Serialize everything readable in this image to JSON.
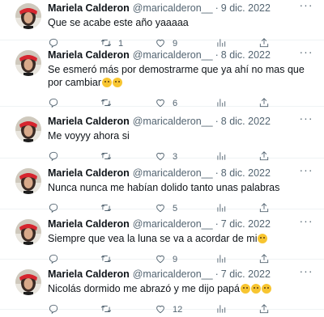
{
  "tweets": [
    {
      "name": "Mariela Calderon",
      "handle": "@maricalderon__",
      "separator": "·",
      "date": "9 dic. 2022",
      "text": "Que se acabe este año yaaaaa",
      "emojis": [],
      "replies": "",
      "retweets": "1",
      "likes": "9",
      "views": ""
    },
    {
      "name": "Mariela Calderon",
      "handle": "@maricalderon__",
      "separator": "·",
      "date": "8 dic. 2022",
      "text": "Se esmeró más por demostrarme que ya ahí no mas que por cambiar",
      "emojis": [
        "worried-face",
        "relieved-face"
      ],
      "replies": "",
      "retweets": "",
      "likes": "6",
      "views": ""
    },
    {
      "name": "Mariela Calderon",
      "handle": "@maricalderon__",
      "separator": "·",
      "date": "8 dic. 2022",
      "text": "Me voyyy ahora si",
      "emojis": [],
      "replies": "",
      "retweets": "",
      "likes": "3",
      "views": ""
    },
    {
      "name": "Mariela Calderon",
      "handle": "@maricalderon__",
      "separator": "·",
      "date": "8 dic. 2022",
      "text": "Nunca nunca me habían dolido tanto unas palabras",
      "emojis": [],
      "replies": "",
      "retweets": "",
      "likes": "5",
      "views": ""
    },
    {
      "name": "Mariela Calderon",
      "handle": "@maricalderon__",
      "separator": "·",
      "date": "7 dic. 2022",
      "text": "Siempre que vea la luna se va a acordar de mi",
      "emojis": [
        "thinking-face"
      ],
      "replies": "",
      "retweets": "",
      "likes": "9",
      "views": ""
    },
    {
      "name": "Mariela Calderon",
      "handle": "@maricalderon__",
      "separator": "·",
      "date": "7 dic. 2022",
      "text": "Nicolás dormido me abrazó y me dijo papá",
      "emojis": [
        "relieved-face",
        "worried-face",
        "joy-face"
      ],
      "replies": "",
      "retweets": "",
      "likes": "12",
      "views": ""
    }
  ],
  "icons": {
    "reply": "reply-icon",
    "retweet": "retweet-icon",
    "like": "heart-icon",
    "views": "views-icon",
    "share": "share-icon",
    "more": "more-icon"
  },
  "colors": {
    "text": "#0f1419",
    "muted": "#536471",
    "divider": "#eff3f4",
    "avatar_red": "#d7262f"
  }
}
